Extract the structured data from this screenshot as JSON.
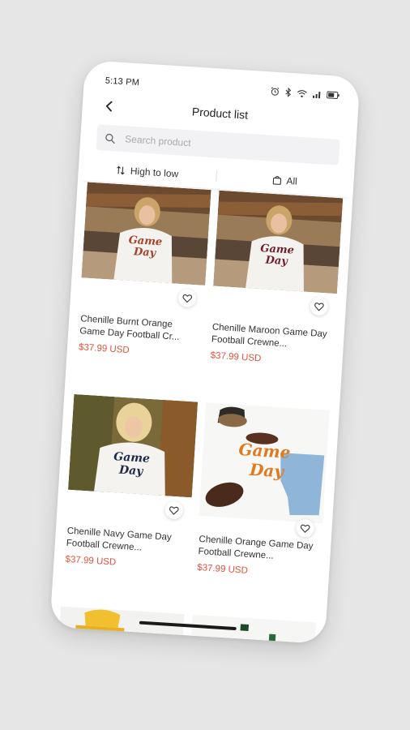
{
  "status_bar": {
    "time": "5:13 PM",
    "icons": [
      "alarm-icon",
      "bluetooth-icon",
      "wifi-icon",
      "signal-icon",
      "battery-icon"
    ]
  },
  "header": {
    "title": "Product list",
    "back_icon": "chevron-left-icon"
  },
  "search": {
    "placeholder": "Search product",
    "value": ""
  },
  "filters": {
    "sort_label": "High to low",
    "category_label": "All"
  },
  "products": [
    {
      "name": "Chenille Burnt Orange Game Day Football Cr...",
      "price": "$37.99 USD",
      "color": "#a8412a"
    },
    {
      "name": "Chenille Maroon Game Day Football Crewne...",
      "price": "$37.99 USD",
      "color": "#6e1f2a"
    },
    {
      "name": "Chenille Navy Game Day Football Crewne...",
      "price": "$37.99 USD",
      "color": "#1f2a4a"
    },
    {
      "name": "Chenille Orange Game Day Football Crewne...",
      "price": "$37.99 USD",
      "color": "#e07a20"
    }
  ],
  "colors": {
    "price": "#e0533d",
    "background": "#e6e6e6",
    "card": "#ffffff"
  }
}
